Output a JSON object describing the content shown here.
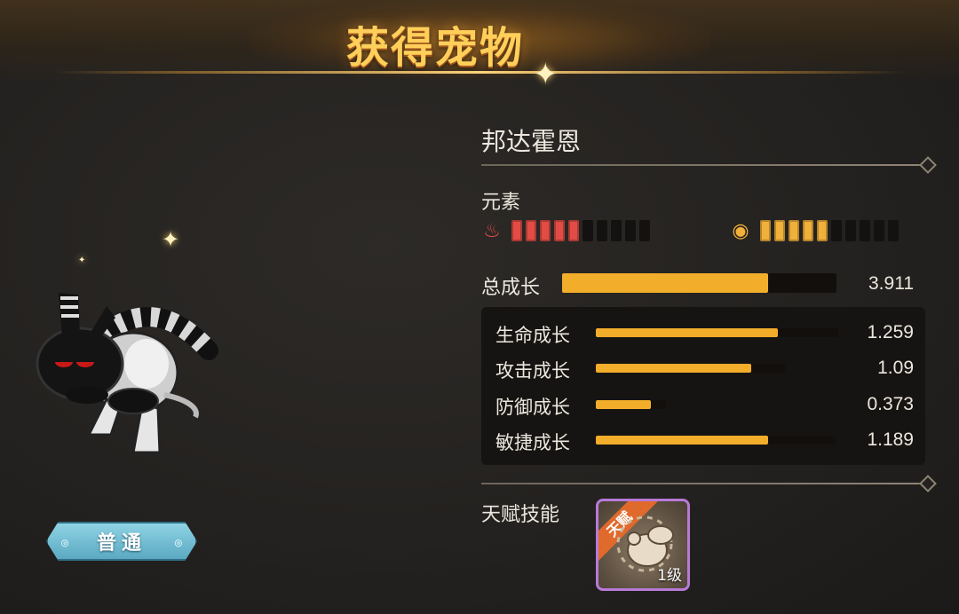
{
  "header": {
    "title": "获得宠物"
  },
  "pet": {
    "name": "邦达霍恩",
    "rarity": "普通"
  },
  "elements": {
    "label": "元素",
    "fire": {
      "icon": "fire-icon",
      "level": 5,
      "max": 10,
      "color": "#e24c45"
    },
    "wind": {
      "icon": "swirl-icon",
      "level": 5,
      "max": 10,
      "color": "#f0b03a"
    }
  },
  "growth": {
    "total_label": "总成长",
    "total_value": "3.911",
    "total_fill": 0.75,
    "stats": [
      {
        "label": "生命成长",
        "value": "1.259",
        "fill": 0.75,
        "track": 1.0
      },
      {
        "label": "攻击成长",
        "value": "1.09",
        "fill": 0.82,
        "track": 0.78
      },
      {
        "label": "防御成长",
        "value": "0.373",
        "fill": 0.78,
        "track": 0.29
      },
      {
        "label": "敏捷成长",
        "value": "1.189",
        "fill": 0.72,
        "track": 0.99
      }
    ]
  },
  "talent": {
    "label": "天赋技能",
    "skill": {
      "ribbon": "天赋",
      "level": "1级",
      "icon": "dog-skill-icon"
    }
  },
  "colors": {
    "accent": "#f2ad2a",
    "title": "#ffcf5a",
    "skill_border": "#b77ad7"
  }
}
